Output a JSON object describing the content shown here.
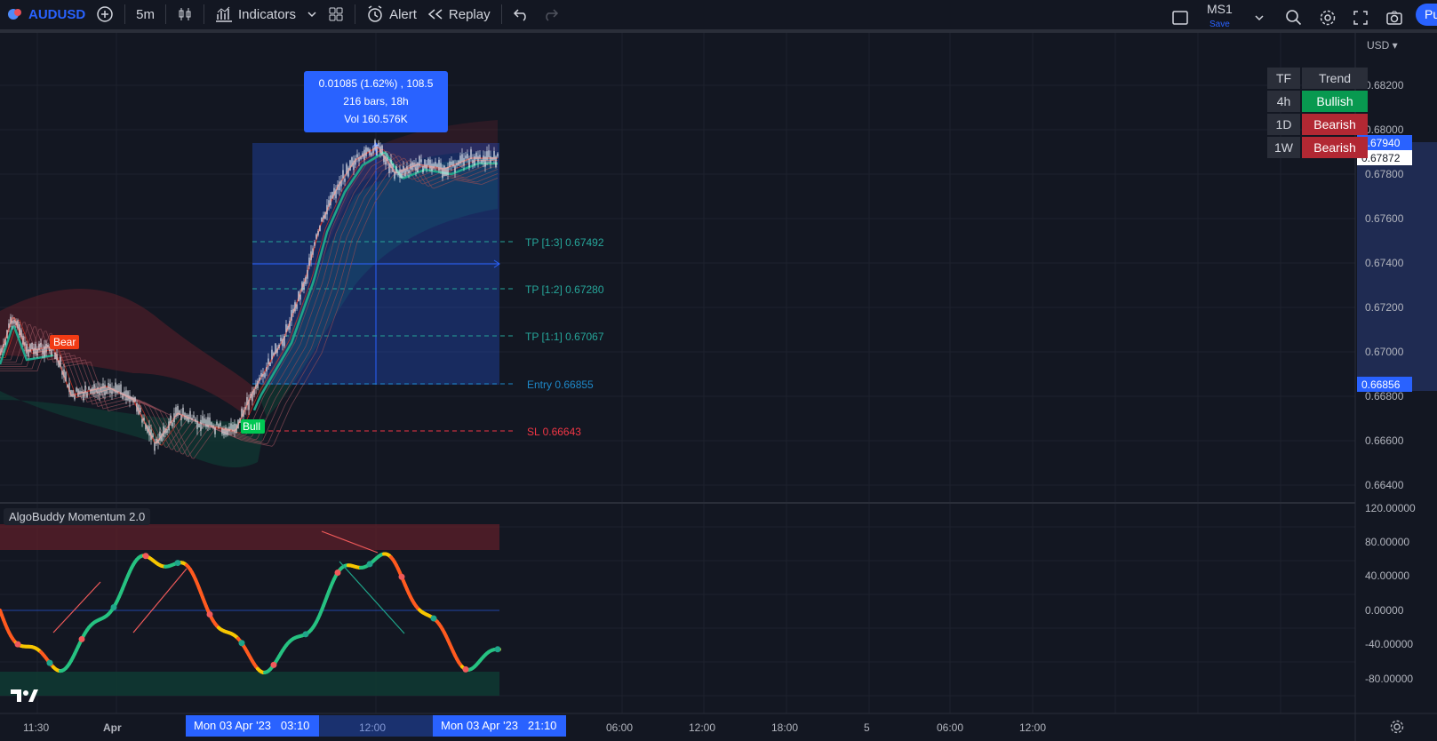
{
  "toolbar": {
    "symbol": "AUDUSD",
    "interval": "5m",
    "indicators_label": "Indicators",
    "alert_label": "Alert",
    "replay_label": "Replay",
    "layout_name": "MS1",
    "save_label": "Save",
    "publish_label": "Pu"
  },
  "price_scale": {
    "currency": "USD",
    "labels": [
      "0.68200",
      "0.68000",
      "0.67800",
      "0.67600",
      "0.67400",
      "0.67200",
      "0.67000",
      "0.66800",
      "0.66600",
      "0.66400"
    ],
    "highlight_top": "0.67940",
    "current_price": "0.67872",
    "entry_price_tag": "0.66856"
  },
  "indicator_scale": {
    "labels": [
      "120.00000",
      "80.00000",
      "40.00000",
      "0.00000",
      "-40.00000",
      "-80.00000"
    ]
  },
  "time_axis": {
    "labels": [
      "11:30",
      "Apr",
      "12:00",
      "06:00",
      "12:00",
      "18:00",
      "5",
      "06:00",
      "12:00"
    ],
    "range_start": "Mon 03 Apr '23   03:10",
    "range_end": "Mon 03 Apr '23   21:10"
  },
  "measure": {
    "line1": "0.01085 (1.62%) , 108.5",
    "line2": "216 bars, 18h",
    "line3": "Vol 160.576K"
  },
  "trade_levels": {
    "tp3": "TP [1:3] 0.67492",
    "tp2": "TP [1:2] 0.67280",
    "tp1": "TP [1:1] 0.67067",
    "entry": "Entry 0.66855",
    "sl": "SL 0.66643"
  },
  "signals": {
    "bear": "Bear",
    "bull": "Bull"
  },
  "trend_table": {
    "headers": [
      "TF",
      "Trend"
    ],
    "rows": [
      {
        "tf": "4h",
        "trend": "Bullish"
      },
      {
        "tf": "1D",
        "trend": "Bearish"
      },
      {
        "tf": "1W",
        "trend": "Bearish"
      }
    ]
  },
  "indicator": {
    "title": "AlgoBuddy Momentum 2.0"
  },
  "colors": {
    "background": "#131722",
    "accent": "#2962ff",
    "bull": "#089950",
    "bear": "#b22833",
    "tp": "#26a69a",
    "sl": "#f23645"
  }
}
